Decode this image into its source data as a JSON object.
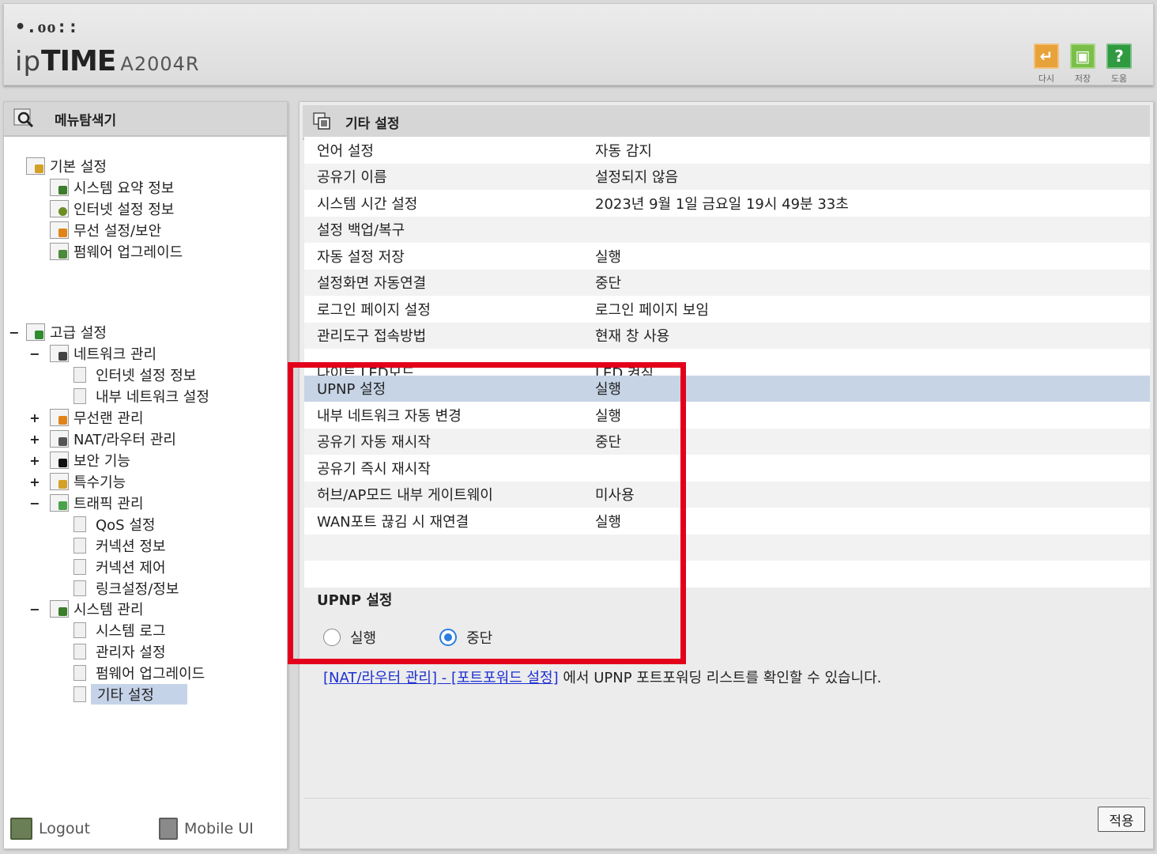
{
  "header": {
    "logo_dots": "•.ᴏᴏ::",
    "logo_ip": "ip",
    "logo_time": "TIME",
    "model": "A2004R",
    "buttons": [
      {
        "label": "다시",
        "icon": "refresh-icon",
        "color": "#e8a23a"
      },
      {
        "label": "저장",
        "icon": "save-icon",
        "color": "#7bbf4a"
      },
      {
        "label": "도움",
        "icon": "help-icon",
        "color": "#2f9a3f"
      }
    ]
  },
  "sidebar": {
    "title": "메뉴탐색기",
    "tree": {
      "basic": "기본 설정",
      "system_summary": "시스템 요약 정보",
      "internet_info": "인터넷 설정 정보",
      "wireless_security": "무선 설정/보안",
      "firmware_upgrade": "펌웨어 업그레이드",
      "advanced": "고급 설정",
      "network_mgmt": "네트워크 관리",
      "net_internet_info": "인터넷 설정 정보",
      "net_internal": "내부 네트워크 설정",
      "wlan_mgmt": "무선랜 관리",
      "nat_router": "NAT/라우터 관리",
      "security": "보안 기능",
      "special": "특수기능",
      "traffic": "트래픽 관리",
      "qos": "QoS 설정",
      "conn_info": "커넥션 정보",
      "conn_control": "커넥션 제어",
      "link": "링크설정/정보",
      "system_mgmt": "시스템 관리",
      "syslog": "시스템 로그",
      "admin": "관리자 설정",
      "sys_firmware": "펌웨어 업그레이드",
      "misc": "기타 설정"
    },
    "expanders": {
      "minus": "−",
      "plus": "+"
    },
    "footer": {
      "logout": "Logout",
      "mobile": "Mobile UI"
    }
  },
  "main": {
    "title": "기타 설정",
    "rows": [
      {
        "label": "언어 설정",
        "value": "자동 감지"
      },
      {
        "label": "공유기 이름",
        "value": "설정되지 않음"
      },
      {
        "label": "시스템 시간 설정",
        "value": "2023년 9월 1일 금요일 19시 49분 33초"
      },
      {
        "label": "설정 백업/복구",
        "value": ""
      },
      {
        "label": "자동 설정 저장",
        "value": "실행"
      },
      {
        "label": "설정화면 자동연결",
        "value": "중단"
      },
      {
        "label": "로그인 페이지 설정",
        "value": "로그인 페이지 보임"
      },
      {
        "label": "관리도구 접속방법",
        "value": "현재 창 사용"
      },
      {
        "label": "나이트 LED모드",
        "value": "LED 켜짐"
      },
      {
        "label": "UPNP 설정",
        "value": "실행"
      },
      {
        "label": "내부 네트워크 자동 변경",
        "value": "실행"
      },
      {
        "label": "공유기 자동 재시작",
        "value": "중단"
      },
      {
        "label": "공유기 즉시 재시작",
        "value": ""
      },
      {
        "label": "허브/AP모드 내부 게이트웨이",
        "value": "미사용"
      },
      {
        "label": "WAN포트 끊김 시 재연결",
        "value": "실행"
      },
      {
        "label": "",
        "value": ""
      },
      {
        "label": "",
        "value": ""
      }
    ],
    "selected_row": "UPNP 설정",
    "section_title": "UPNP 설정",
    "radio_options": {
      "run": "실행",
      "stop": "중단",
      "selected": "중단"
    },
    "note_link": "[NAT/라우터 관리] - [포트포워드 설정]",
    "note_text": " 에서 UPNP 포트포워딩 리스트를 확인할 수 있습니다.",
    "apply_label": "적용"
  },
  "colors": {
    "highlight_box": "#e3001b",
    "selected_row": "#c6d4e6",
    "radio_accent": "#2b7de0",
    "link": "#1d2fd1"
  }
}
